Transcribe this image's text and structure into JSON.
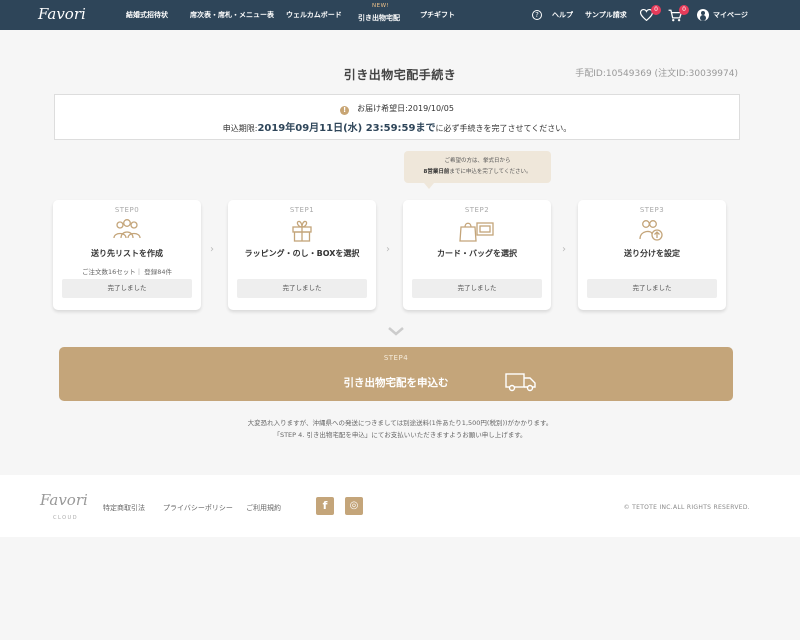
{
  "header": {
    "logo": "Favori",
    "nav": [
      {
        "label": "結婚式招待状"
      },
      {
        "label": "席次表・席札・メニュー表"
      },
      {
        "label": "ウェルカムボード"
      },
      {
        "label": "引き出物宅配",
        "badge": "NEW!"
      },
      {
        "label": "プチギフト"
      }
    ],
    "help_label": "ヘルプ",
    "help_icon": "?",
    "sample_label": "サンプル請求",
    "favorites_count": "0",
    "cart_count": "0",
    "mypage_label": "マイページ"
  },
  "page": {
    "title": "引き出物宅配手続き",
    "order_id": "手配ID:10549369 (注文ID:30039974)"
  },
  "deadline": {
    "warn_icon": "!",
    "delivery_label": "お届け希望日:",
    "delivery_date": "2019/10/05",
    "deadline_label": "申込期限:",
    "deadline_date": "2019年09月11日(水) 23:59:59まで",
    "deadline_suffix": "に必ず手続きを完了させてください。"
  },
  "tooltip": {
    "line1": "ご希望の方は、挙式日から",
    "line2_bold": "8営業日前",
    "line2_rest": "までに申込を完了してください。"
  },
  "steps": [
    {
      "label": "STEP0",
      "title": "送り先リストを作成",
      "sub": "ご注文数16セット｜ 登録84件",
      "status": "完了しました"
    },
    {
      "label": "STEP1",
      "title": "ラッピング・のし・BOXを選択",
      "sub": "",
      "status": "完了しました"
    },
    {
      "label": "STEP2",
      "title": "カード・バッグを選択",
      "sub": "",
      "status": "完了しました"
    },
    {
      "label": "STEP3",
      "title": "送り分けを設定",
      "sub": "",
      "status": "完了しました"
    }
  ],
  "step4": {
    "label": "STEP4",
    "title": "引き出物宅配を申込む"
  },
  "notes": {
    "line1": "大変恐れ入りますが、沖縄県への発送につきましては別途送料(1件あたり1,500円(税別))がかかります。",
    "line2": "「STEP 4. 引き出物宅配を申込」にてお支払いいただきますようお願い申し上げます。"
  },
  "footer": {
    "logo": "Favori",
    "logo_sub": "CLOUD",
    "links": [
      "特定商取引法",
      "プライバシーポリシー",
      "ご利用規約"
    ],
    "facebook": "f",
    "instagram": "◎",
    "copyright": "© TETOTE INC.ALL RIGHTS RESERVED."
  },
  "colors": {
    "header_bg": "#2e4559",
    "accent_gold": "#c4a57a",
    "badge_red": "#e63b5a"
  }
}
